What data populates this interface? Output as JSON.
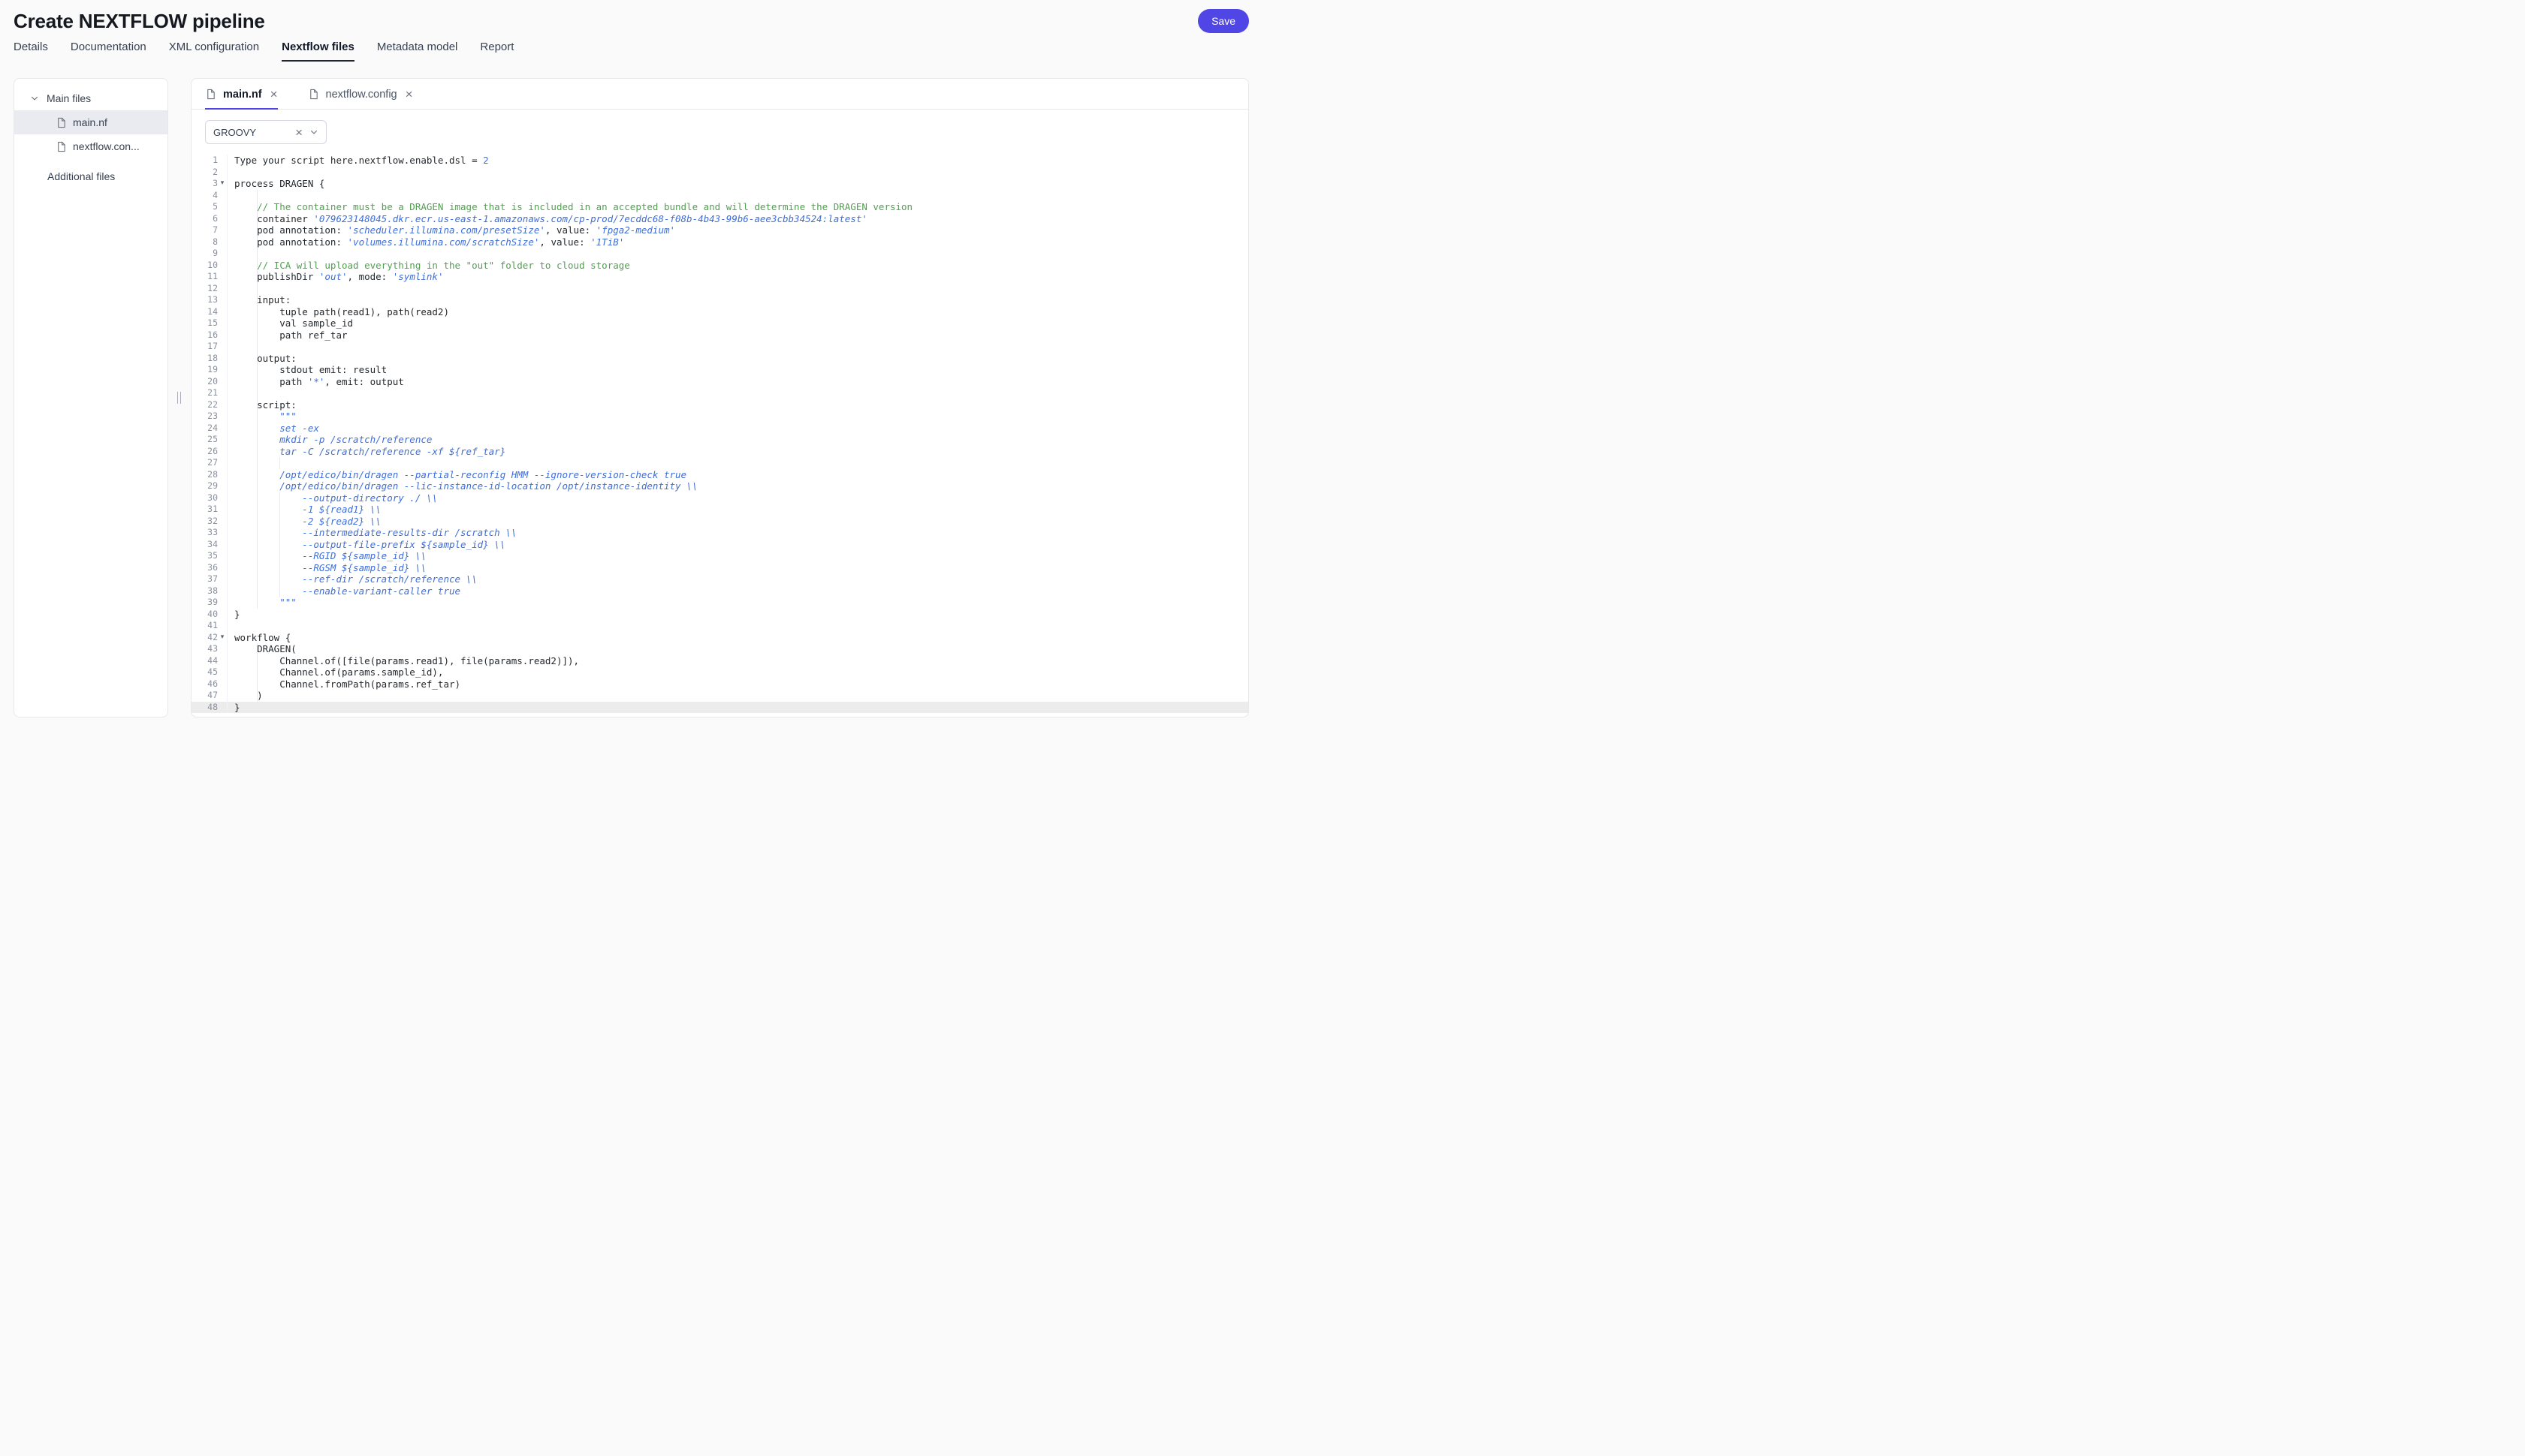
{
  "page": {
    "title": "Create NEXTFLOW pipeline",
    "save_label": "Save",
    "accent": "#4f46e5"
  },
  "main_tabs": [
    {
      "label": "Details",
      "active": false
    },
    {
      "label": "Documentation",
      "active": false
    },
    {
      "label": "XML configuration",
      "active": false
    },
    {
      "label": "Nextflow files",
      "active": true
    },
    {
      "label": "Metadata model",
      "active": false
    },
    {
      "label": "Report",
      "active": false
    }
  ],
  "sidebar": {
    "sections": {
      "main_files": "Main files",
      "additional_files": "Additional files"
    },
    "files": [
      {
        "label": "main.nf",
        "selected": true
      },
      {
        "label": "nextflow.con...",
        "selected": false
      }
    ]
  },
  "editor": {
    "file_tabs": [
      {
        "label": "main.nf",
        "active": true
      },
      {
        "label": "nextflow.config",
        "active": false
      }
    ],
    "language": "GROOVY",
    "colors": {
      "plain": "#24292e",
      "comment": "#50a14f",
      "string": "#3e6ed8",
      "number": "#3e6ed8"
    },
    "lines": [
      {
        "n": 1,
        "t": [
          [
            "p",
            "Type your script here.nextflow.enable.dsl = "
          ],
          [
            "n",
            "2"
          ]
        ]
      },
      {
        "n": 2,
        "t": []
      },
      {
        "n": 3,
        "fold": true,
        "t": [
          [
            "p",
            "process DRAGEN {"
          ]
        ]
      },
      {
        "n": 4,
        "g": [
          4
        ],
        "t": []
      },
      {
        "n": 5,
        "g": [
          4
        ],
        "t": [
          [
            "c",
            "    // The container must be a DRAGEN image that is included in an accepted bundle and will determine the DRAGEN version"
          ]
        ]
      },
      {
        "n": 6,
        "g": [
          4
        ],
        "t": [
          [
            "p",
            "    container "
          ],
          [
            "s",
            "'079623148045.dkr.ecr.us-east-1.amazonaws.com/cp-prod/7ecddc68-f08b-4b43-99b6-aee3cbb34524:latest'"
          ]
        ]
      },
      {
        "n": 7,
        "g": [
          4
        ],
        "t": [
          [
            "p",
            "    pod annotation: "
          ],
          [
            "s",
            "'scheduler.illumina.com/presetSize'"
          ],
          [
            "p",
            ", value: "
          ],
          [
            "s",
            "'fpga2-medium'"
          ]
        ]
      },
      {
        "n": 8,
        "g": [
          4
        ],
        "t": [
          [
            "p",
            "    pod annotation: "
          ],
          [
            "s",
            "'volumes.illumina.com/scratchSize'"
          ],
          [
            "p",
            ", value: "
          ],
          [
            "s",
            "'1TiB'"
          ]
        ]
      },
      {
        "n": 9,
        "g": [
          4
        ],
        "t": []
      },
      {
        "n": 10,
        "g": [
          4
        ],
        "t": [
          [
            "c",
            "    // ICA will upload everything in the \"out\" folder to cloud storage"
          ]
        ]
      },
      {
        "n": 11,
        "g": [
          4
        ],
        "t": [
          [
            "p",
            "    publishDir "
          ],
          [
            "s",
            "'out'"
          ],
          [
            "p",
            ", mode: "
          ],
          [
            "s",
            "'symlink'"
          ]
        ]
      },
      {
        "n": 12,
        "g": [
          4
        ],
        "t": []
      },
      {
        "n": 13,
        "g": [
          4
        ],
        "t": [
          [
            "p",
            "    input:"
          ]
        ]
      },
      {
        "n": 14,
        "g": [
          4
        ],
        "t": [
          [
            "p",
            "        tuple path(read1), path(read2)"
          ]
        ]
      },
      {
        "n": 15,
        "g": [
          4
        ],
        "t": [
          [
            "p",
            "        val sample_id"
          ]
        ]
      },
      {
        "n": 16,
        "g": [
          4
        ],
        "t": [
          [
            "p",
            "        path ref_tar"
          ]
        ]
      },
      {
        "n": 17,
        "g": [
          4
        ],
        "t": []
      },
      {
        "n": 18,
        "g": [
          4
        ],
        "t": [
          [
            "p",
            "    output:"
          ]
        ]
      },
      {
        "n": 19,
        "g": [
          4
        ],
        "t": [
          [
            "p",
            "        stdout emit: result"
          ]
        ]
      },
      {
        "n": 20,
        "g": [
          4
        ],
        "t": [
          [
            "p",
            "        path "
          ],
          [
            "s",
            "'*'"
          ],
          [
            "p",
            ", emit: output"
          ]
        ]
      },
      {
        "n": 21,
        "g": [
          4
        ],
        "t": []
      },
      {
        "n": 22,
        "g": [
          4
        ],
        "t": [
          [
            "p",
            "    script:"
          ]
        ]
      },
      {
        "n": 23,
        "g": [
          4
        ],
        "t": [
          [
            "s",
            "        \"\"\""
          ]
        ]
      },
      {
        "n": 24,
        "g": [
          4
        ],
        "t": [
          [
            "s",
            "        set -ex"
          ]
        ]
      },
      {
        "n": 25,
        "g": [
          4
        ],
        "t": [
          [
            "s",
            "        mkdir -p /scratch/reference"
          ]
        ]
      },
      {
        "n": 26,
        "g": [
          4
        ],
        "t": [
          [
            "s",
            "        tar -C /scratch/reference -xf ${ref_tar}"
          ]
        ]
      },
      {
        "n": 27,
        "g": [
          4,
          8
        ],
        "t": []
      },
      {
        "n": 28,
        "g": [
          4
        ],
        "t": [
          [
            "s",
            "        /opt/edico/bin/dragen --partial-reconfig HMM --ignore-version-check true"
          ]
        ]
      },
      {
        "n": 29,
        "g": [
          4
        ],
        "t": [
          [
            "s",
            "        /opt/edico/bin/dragen --lic-instance-id-location /opt/instance-identity \\\\"
          ]
        ]
      },
      {
        "n": 30,
        "g": [
          4,
          8
        ],
        "t": [
          [
            "s",
            "            --output-directory ./ \\\\"
          ]
        ]
      },
      {
        "n": 31,
        "g": [
          4,
          8
        ],
        "t": [
          [
            "s",
            "            -1 ${read1} \\\\"
          ]
        ]
      },
      {
        "n": 32,
        "g": [
          4,
          8
        ],
        "t": [
          [
            "s",
            "            -2 ${read2} \\\\"
          ]
        ]
      },
      {
        "n": 33,
        "g": [
          4,
          8
        ],
        "t": [
          [
            "s",
            "            --intermediate-results-dir /scratch \\\\"
          ]
        ]
      },
      {
        "n": 34,
        "g": [
          4,
          8
        ],
        "t": [
          [
            "s",
            "            --output-file-prefix ${sample_id} \\\\"
          ]
        ]
      },
      {
        "n": 35,
        "g": [
          4,
          8
        ],
        "t": [
          [
            "s",
            "            --RGID ${sample_id} \\\\"
          ]
        ]
      },
      {
        "n": 36,
        "g": [
          4,
          8
        ],
        "t": [
          [
            "s",
            "            --RGSM ${sample_id} \\\\"
          ]
        ]
      },
      {
        "n": 37,
        "g": [
          4,
          8
        ],
        "t": [
          [
            "s",
            "            --ref-dir /scratch/reference \\\\"
          ]
        ]
      },
      {
        "n": 38,
        "g": [
          4,
          8
        ],
        "t": [
          [
            "s",
            "            --enable-variant-caller true"
          ]
        ]
      },
      {
        "n": 39,
        "g": [
          4
        ],
        "t": [
          [
            "s",
            "        \"\"\""
          ]
        ]
      },
      {
        "n": 40,
        "t": [
          [
            "p",
            "}"
          ]
        ]
      },
      {
        "n": 41,
        "t": []
      },
      {
        "n": 42,
        "fold": true,
        "t": [
          [
            "p",
            "workflow {"
          ]
        ]
      },
      {
        "n": 43,
        "g": [
          4
        ],
        "t": [
          [
            "p",
            "    DRAGEN("
          ]
        ]
      },
      {
        "n": 44,
        "g": [
          4
        ],
        "t": [
          [
            "p",
            "        Channel.of([file(params.read1), file(params.read2)]),"
          ]
        ]
      },
      {
        "n": 45,
        "g": [
          4
        ],
        "t": [
          [
            "p",
            "        Channel.of(params.sample_id),"
          ]
        ]
      },
      {
        "n": 46,
        "g": [
          4
        ],
        "t": [
          [
            "p",
            "        Channel.fromPath(params.ref_tar)"
          ]
        ]
      },
      {
        "n": 47,
        "g": [
          4
        ],
        "t": [
          [
            "p",
            "    )"
          ]
        ]
      },
      {
        "n": 48,
        "hl": true,
        "t": [
          [
            "p",
            "}"
          ]
        ]
      }
    ]
  }
}
